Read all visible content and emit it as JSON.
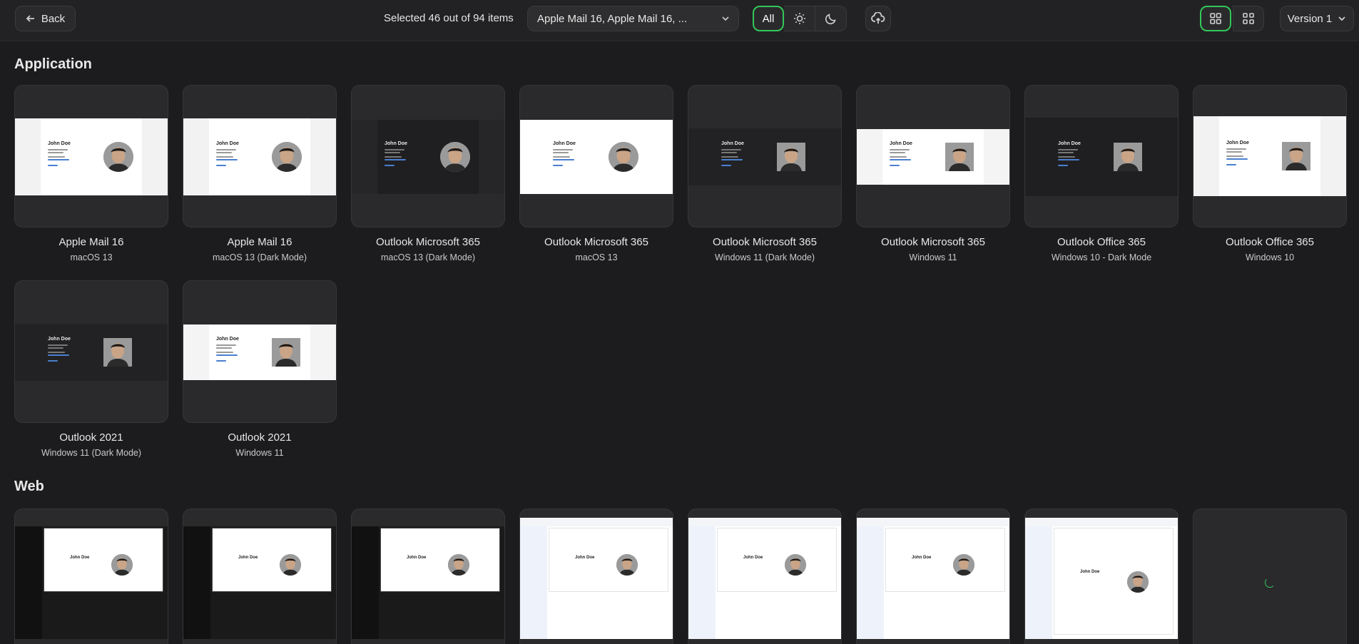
{
  "toolbar": {
    "back_label": "Back",
    "selection_text": "Selected 46 out of 94 items",
    "client_dropdown_value": "Apple Mail 16, Apple Mail 16, ...",
    "mode_all_label": "All",
    "version_label": "Version 1"
  },
  "sections": {
    "application": {
      "title": "Application",
      "cards": [
        {
          "name": "Apple Mail 16",
          "sub": "macOS 13"
        },
        {
          "name": "Apple Mail 16",
          "sub": "macOS 13 (Dark Mode)"
        },
        {
          "name": "Outlook Microsoft 365",
          "sub": "macOS 13 (Dark Mode)"
        },
        {
          "name": "Outlook Microsoft 365",
          "sub": "macOS 13"
        },
        {
          "name": "Outlook Microsoft 365",
          "sub": "Windows 11 (Dark Mode)"
        },
        {
          "name": "Outlook Microsoft 365",
          "sub": "Windows 11"
        },
        {
          "name": "Outlook Office 365",
          "sub": "Windows 10 - Dark Mode"
        },
        {
          "name": "Outlook Office 365",
          "sub": "Windows 10"
        },
        {
          "name": "Outlook 2021",
          "sub": "Windows 11 (Dark Mode)"
        },
        {
          "name": "Outlook 2021",
          "sub": "Windows 11"
        }
      ]
    },
    "web": {
      "title": "Web"
    }
  },
  "signature": {
    "name": "John Doe"
  },
  "colors": {
    "accent": "#34c759",
    "background": "#1c1c1e",
    "card": "#2a2a2c"
  }
}
